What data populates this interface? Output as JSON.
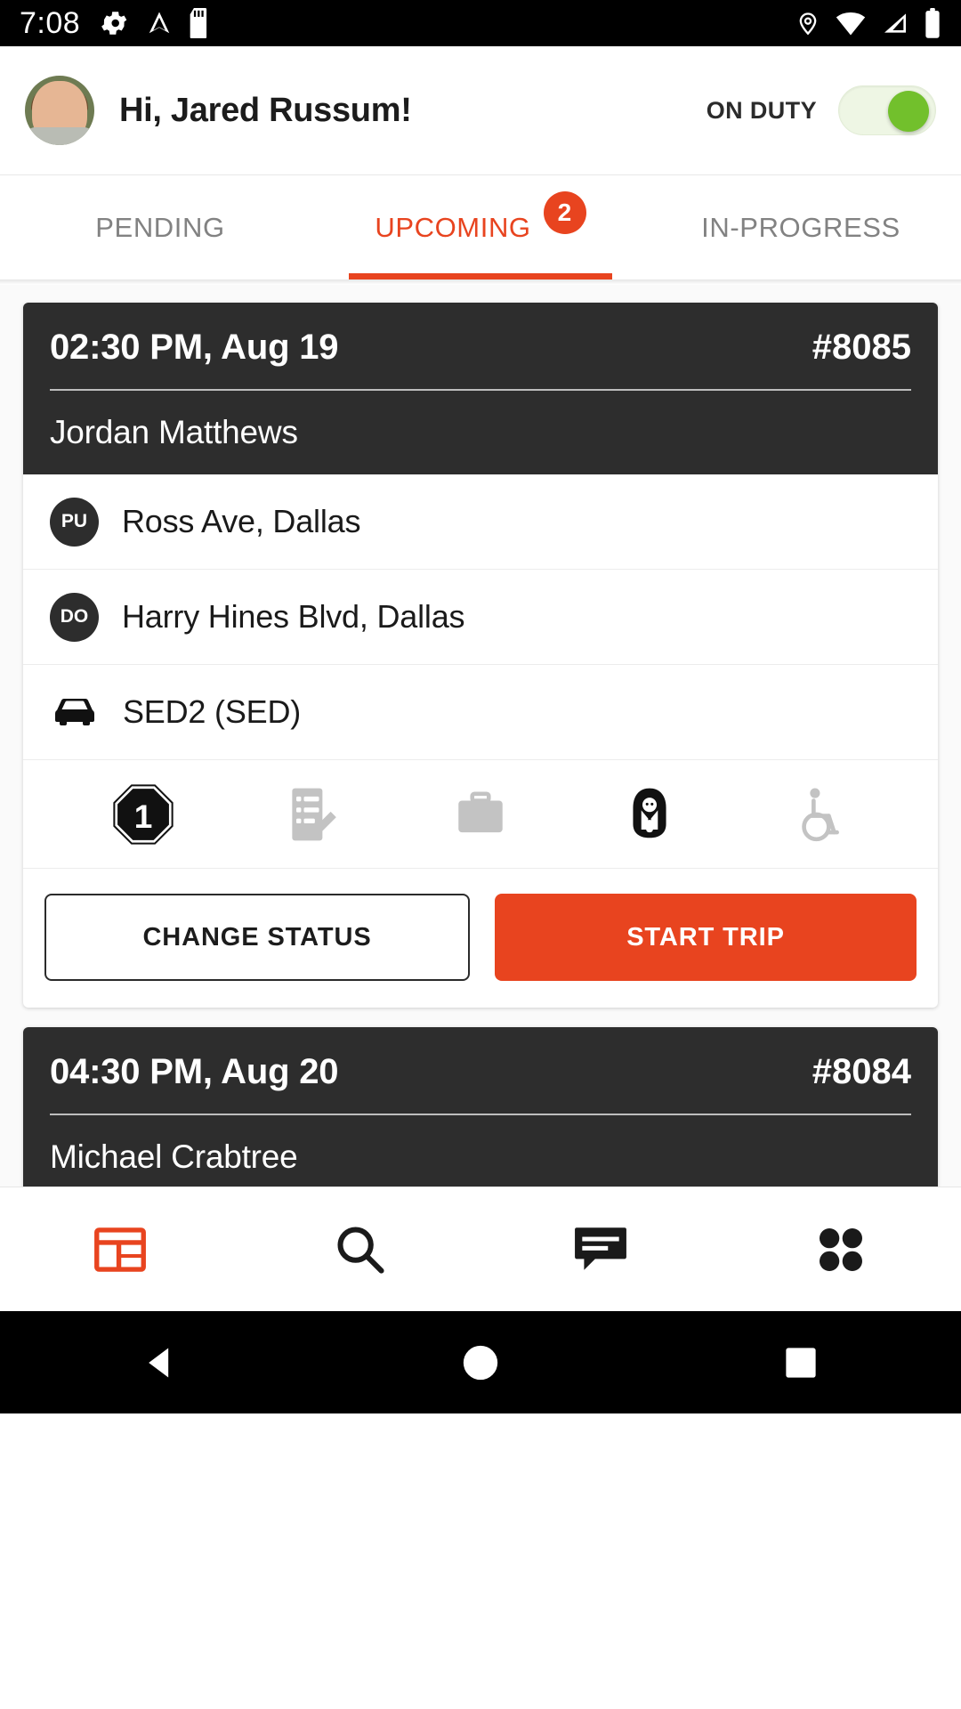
{
  "status_bar": {
    "time": "7:08",
    "left_icons": [
      "gear-icon",
      "navigation-arrow-icon",
      "sd-card-icon"
    ],
    "right_icons": [
      "location-pin-icon",
      "wifi-icon",
      "cellular-signal-icon",
      "battery-icon"
    ]
  },
  "header": {
    "greeting": "Hi, Jared Russum!",
    "duty_label": "ON DUTY",
    "duty_on": true,
    "toggle_on_color": "#72c02c"
  },
  "tabs": {
    "accent_color": "#e8441f",
    "items": [
      {
        "label": "PENDING",
        "active": false,
        "badge": ""
      },
      {
        "label": "UPCOMING",
        "active": true,
        "badge": "2"
      },
      {
        "label": "IN-PROGRESS",
        "active": false,
        "badge": ""
      }
    ]
  },
  "trips": [
    {
      "time": "02:30 PM, Aug 19",
      "id": "#8085",
      "passenger": "Jordan Matthews",
      "pickup_tag": "PU",
      "pickup": "Ross Ave, Dallas",
      "dropoff_tag": "DO",
      "dropoff": "Harry Hines Blvd, Dallas",
      "vehicle": "SED2 (SED)",
      "amenities": [
        {
          "icon": "passenger-count-icon",
          "value": "1",
          "active": true
        },
        {
          "icon": "notes-edit-icon",
          "value": "",
          "active": false
        },
        {
          "icon": "luggage-icon",
          "value": "",
          "active": false
        },
        {
          "icon": "child-seat-icon",
          "value": "",
          "active": true
        },
        {
          "icon": "wheelchair-icon",
          "value": "",
          "active": false
        }
      ],
      "secondary_action": "CHANGE STATUS",
      "primary_action": "START TRIP"
    },
    {
      "time": "04:30 PM, Aug 20",
      "id": "#8084",
      "passenger": "Michael Crabtree"
    }
  ],
  "bottom_nav": {
    "items": [
      {
        "icon": "dashboard-icon",
        "active": true
      },
      {
        "icon": "search-icon",
        "active": false
      },
      {
        "icon": "messages-icon",
        "active": false
      },
      {
        "icon": "apps-grid-icon",
        "active": false
      }
    ],
    "active_color": "#e8441f"
  },
  "system_nav": {
    "items": [
      "back-button",
      "home-button",
      "recents-button"
    ]
  }
}
